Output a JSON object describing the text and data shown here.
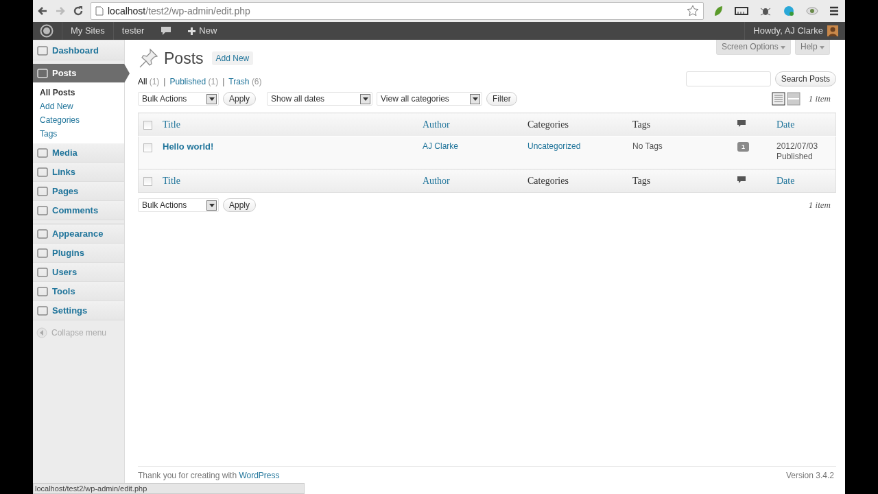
{
  "browser": {
    "url_host": "localhost",
    "url_path": "/test2/wp-admin/edit.php"
  },
  "admin_bar": {
    "items": [
      "My Sites",
      "tester"
    ],
    "new_label": "New",
    "greeting": "Howdy, AJ Clarke"
  },
  "sidebar": {
    "menu": [
      {
        "label": "Dashboard",
        "selected": false
      },
      {
        "label": "Posts",
        "selected": true,
        "children": [
          {
            "label": "All Posts",
            "selected": true
          },
          {
            "label": "Add New",
            "selected": false
          },
          {
            "label": "Categories",
            "selected": false
          },
          {
            "label": "Tags",
            "selected": false
          }
        ]
      },
      {
        "label": "Media",
        "selected": false
      },
      {
        "label": "Links",
        "selected": false
      },
      {
        "label": "Pages",
        "selected": false
      },
      {
        "label": "Comments",
        "selected": false
      },
      {
        "label": "Appearance",
        "selected": false
      },
      {
        "label": "Plugins",
        "selected": false
      },
      {
        "label": "Users",
        "selected": false
      },
      {
        "label": "Tools",
        "selected": false
      },
      {
        "label": "Settings",
        "selected": false
      }
    ],
    "collapse": "Collapse menu"
  },
  "page": {
    "title": "Posts",
    "add_new": "Add New",
    "screen_options": "Screen Options",
    "help": "Help"
  },
  "filters": [
    {
      "label": "All",
      "count": "(1)",
      "selected": true
    },
    {
      "separator": "|",
      "label": "Published",
      "count": "(1)",
      "selected": false
    },
    {
      "separator": "|",
      "label": "Trash",
      "count": "(6)",
      "selected": false
    }
  ],
  "search_button": "Search Posts",
  "top_actions": {
    "bulk": "Bulk Actions",
    "apply": "Apply",
    "dates": "Show all dates",
    "categories": "View all categories",
    "filter": "Filter",
    "view_modes": [
      {
        "selected": true
      },
      {
        "selected": false
      }
    ],
    "count": "1 item"
  },
  "table": {
    "header": {
      "checked": false,
      "columns": [
        {
          "label": "Title",
          "sortable": true,
          "kind": "text"
        },
        {
          "label": "Author",
          "sortable": true,
          "kind": "text"
        },
        {
          "label": "Categories",
          "sortable": false,
          "kind": "text"
        },
        {
          "label": "Tags",
          "sortable": false,
          "kind": "text"
        },
        {
          "kind": "comments"
        },
        {
          "label": "Date",
          "sortable": true,
          "kind": "text"
        }
      ]
    },
    "footer": {
      "checked": false,
      "columns": [
        {
          "label": "Title",
          "sortable": true,
          "kind": "text"
        },
        {
          "label": "Author",
          "sortable": true,
          "kind": "text"
        },
        {
          "label": "Categories",
          "sortable": false,
          "kind": "text"
        },
        {
          "label": "Tags",
          "sortable": false,
          "kind": "text"
        },
        {
          "kind": "comments"
        },
        {
          "label": "Date",
          "sortable": true,
          "kind": "text"
        }
      ]
    },
    "rows": [
      {
        "checked": false,
        "title": "Hello world!",
        "author": "AJ Clarke",
        "category": "Uncategorized",
        "tags": "No Tags",
        "comments": "1",
        "date": "2012/07/03",
        "status": "Published"
      }
    ]
  },
  "bottom_actions": {
    "bulk": "Bulk Actions",
    "apply": "Apply",
    "count": "1 item"
  },
  "footer": {
    "thanks": "Thank you for creating with",
    "link": "WordPress",
    "version": "Version 3.4.2"
  },
  "status_url": "localhost/test2/wp-admin/edit.php"
}
